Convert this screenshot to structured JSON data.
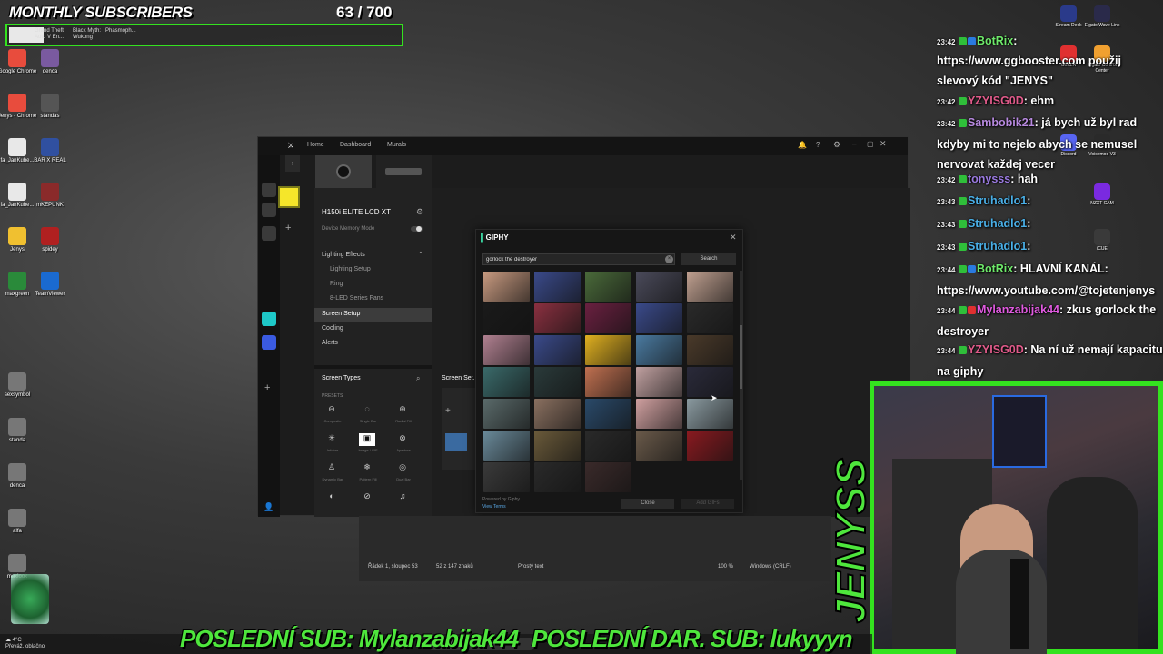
{
  "overlay": {
    "subs_title": "MONTHLY SUBSCRIBERS",
    "subs_current": "63",
    "subs_goal": "/ 700",
    "bar_games": [
      "Grand Theft Auto V En...",
      "Black Myth: Wukong",
      "Phasmoph..."
    ]
  },
  "desktop_icons": [
    {
      "label": "Google Chrome",
      "color": "#e84c3d"
    },
    {
      "label": "denca",
      "color": "#7a5aa0"
    },
    {
      "label": "Jenys - Chrome",
      "color": "#e84c3d"
    },
    {
      "label": "standas",
      "color": "#555555"
    },
    {
      "label": "fa_JanKube...",
      "color": "#e8e8e8"
    },
    {
      "label": "BAR X REAL",
      "color": "#3050a0"
    },
    {
      "label": "fa_JanKube...",
      "color": "#e8e8e8"
    },
    {
      "label": "mKEPUNK",
      "color": "#8a2a2a"
    },
    {
      "label": "Jenys",
      "color": "#f0c030"
    },
    {
      "label": "spidey",
      "color": "#b02020"
    },
    {
      "label": "maxgreen",
      "color": "#2a8a3a"
    },
    {
      "label": "TeamViewer",
      "color": "#1a6ad0"
    },
    {
      "label": "sexsymbol",
      "color": "#777777"
    },
    {
      "label": "standa",
      "color": "#777777"
    },
    {
      "label": "denca",
      "color": "#777777"
    },
    {
      "label": "alfa",
      "color": "#777777"
    },
    {
      "label": "maxlook",
      "color": "#777777"
    }
  ],
  "icue": {
    "nav": [
      "Home",
      "Dashboard",
      "Murals"
    ],
    "device_name": "H150i ELITE LCD XT",
    "device_memory_mode": "Device Memory Mode",
    "side_items": [
      {
        "label": "Lighting Effects",
        "sub": false
      },
      {
        "label": "Lighting Setup",
        "sub": true
      },
      {
        "label": "Ring",
        "sub": true
      },
      {
        "label": "8-LED Series Fans",
        "sub": true
      },
      {
        "label": "Screen Setup",
        "sub": false,
        "selected": true
      },
      {
        "label": "Cooling",
        "sub": false
      },
      {
        "label": "Alerts",
        "sub": false
      }
    ],
    "screen_types": "Screen Types",
    "presets": "PRESETS",
    "preset_labels": [
      "Composite",
      "Single Bar",
      "Radial Fill",
      "Infobar",
      "Image / GIF",
      "Aperture",
      "Dynamic Bar",
      "Pattern Fill",
      "Dual Bar"
    ],
    "screen_setup_tab": "Screen Set..."
  },
  "giphy": {
    "title": "GIPHY",
    "search_value": "gorlock the destroyer",
    "search_button": "Search",
    "powered_by": "Powered by Giphy",
    "view_terms": "View Terms",
    "close_button": "Close",
    "add_button": "Add GIFs",
    "gif_colors": [
      [
        "#c89a80",
        "#3a4a8a",
        "#4a6a3a",
        "#4a4a5a",
        "#c0a090"
      ],
      [
        "#1a1a1a",
        "#8a3040",
        "#6a2040",
        "#3a4a8a",
        "#2a2a2a"
      ],
      [
        "#b08090",
        "#3a4a8a",
        "#e0b020",
        "#4a7aa0",
        "#4a3a2a"
      ],
      [
        "#3a6a6a",
        "#2a3a3a",
        "#c07050",
        "#c0a0a0",
        "#2a2a3a"
      ],
      [
        "#5a6a6a",
        "#8a7060",
        "#2a4a6a",
        "#d0a0a0",
        "#8a9aa0"
      ],
      [
        "#6a8a9a",
        "#6a5a3a",
        "#2a2a2a",
        "#6a5a4a",
        "#8a1a20"
      ],
      [
        "#3a3a3a",
        "#2a2a2a",
        "#3a2a2a",
        "",
        ""
      ]
    ]
  },
  "notepad": {
    "position": "Řádek 1, sloupec 53",
    "chars": "52 z 147 znaků",
    "format": "Prostý text",
    "zoom": "100 %",
    "eol": "Windows (CRLF)"
  },
  "chat": [
    {
      "time": "23:42",
      "user": "BotRix",
      "user_color": "#6ee86a",
      "msg": ":",
      "badges": [
        "#2fbf3a",
        "#2a7ae0"
      ]
    },
    {
      "time": "",
      "user": "",
      "user_color": "#ffffff",
      "msg": "https://www.ggbooster.com použij slevový kód \"JENYS\"",
      "badges": []
    },
    {
      "time": "23:42",
      "user": "YZYISG0D",
      "user_color": "#e05a8a",
      "msg": ": ehm",
      "badges": [
        "#2fbf3a"
      ]
    },
    {
      "time": "23:42",
      "user": "Sambobik21",
      "user_color": "#b88ae0",
      "msg": ": já bych už byl rad kdyby mi to nejelo abych se nemusel nervovat každej vecer",
      "badges": [
        "#2fbf3a"
      ]
    },
    {
      "time": "23:42",
      "user": "tonysss",
      "user_color": "#9a7ae0",
      "msg": ": hah",
      "badges": [
        "#2fbf3a"
      ]
    },
    {
      "time": "23:43",
      "user": "Struhadlo1",
      "user_color": "#4ab0e8",
      "msg": ":",
      "badges": [
        "#2fbf3a"
      ]
    },
    {
      "time": "23:43",
      "user": "Struhadlo1",
      "user_color": "#4ab0e8",
      "msg": ":",
      "badges": [
        "#2fbf3a"
      ]
    },
    {
      "time": "23:43",
      "user": "Struhadlo1",
      "user_color": "#4ab0e8",
      "msg": ":",
      "badges": [
        "#2fbf3a"
      ]
    },
    {
      "time": "23:44",
      "user": "BotRix",
      "user_color": "#6ee86a",
      "msg": ": HLAVNÍ KANÁL: https://www.youtube.com/@tojetenjenys",
      "badges": [
        "#2fbf3a",
        "#2a7ae0"
      ]
    },
    {
      "time": "23:44",
      "user": "Mylanzabijak44",
      "user_color": "#e05ae0",
      "msg": ": zkus gorlock the destroyer",
      "badges": [
        "#2fbf3a",
        "#e03030"
      ]
    },
    {
      "time": "23:44",
      "user": "YZYISG0D",
      "user_color": "#e05a8a",
      "msg": ": Na ní už nemají kapacitu na giphy",
      "badges": [
        "#2fbf3a"
      ]
    }
  ],
  "dock_icons": [
    {
      "label": "Stream Deck",
      "color": "#2a3a8a"
    },
    {
      "label": "Elgato Wave Link",
      "color": "#2a2a4a"
    },
    {
      "label": "GoXLR",
      "color": "#e03030"
    },
    {
      "label": "Elgato Control Center",
      "color": "#f0a030"
    },
    {
      "label": "Discord",
      "color": "#5865f2"
    },
    {
      "label": "Voicemod V3",
      "color": "#2a2a2a"
    },
    {
      "label": "NZXT CAM",
      "color": "#7a2ae0"
    },
    {
      "label": "iCUE",
      "color": "#3a3a3a"
    }
  ],
  "streamer_name": "JENYSS",
  "ticker": {
    "last_sub": "POSLEDNÍ SUB: Mylanzabijak44",
    "last_paid_sub": "POSLEDNÍ DAR. SUB: lukyyyn"
  },
  "taskbar": {
    "weather_temp": "4°C",
    "weather_desc": "Převáž. oblačno",
    "search_placeholder": "Hledat"
  },
  "colors": {
    "overlay_green": "#34e21f",
    "ticker_green": "#4ee63c",
    "icue_accent": "#f5e62a",
    "link_blue": "#5aa8e6"
  }
}
